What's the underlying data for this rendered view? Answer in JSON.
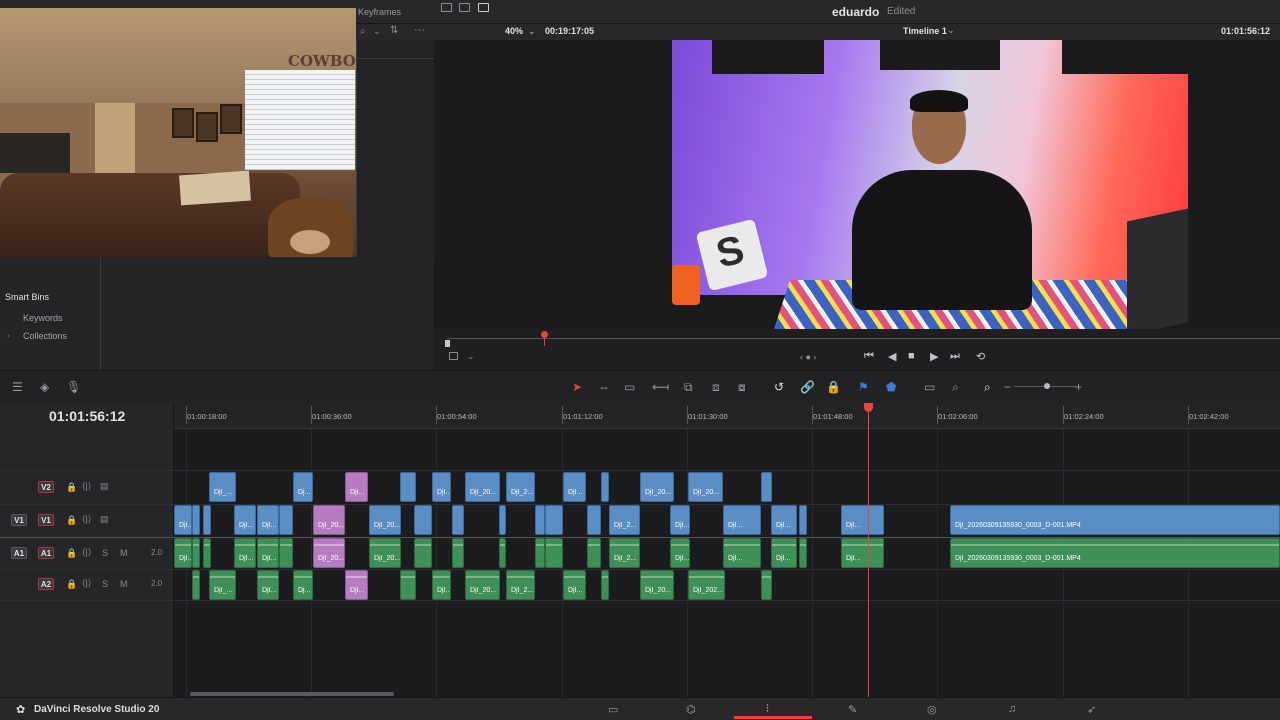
{
  "app": {
    "name": "DaVinci Resolve Studio 20"
  },
  "project": {
    "name": "eduardo",
    "status": "Edited"
  },
  "inspector": {
    "keyframes_label": "Keyframes"
  },
  "viewer": {
    "zoom": "40%",
    "source_timecode": "00:19:17:05",
    "timeline_name": "Timeline 1",
    "record_timecode": "01:01:56:12"
  },
  "media": {
    "smart_bins_title": "Smart Bins",
    "items": [
      {
        "label": "Keywords"
      },
      {
        "label": "Collections"
      }
    ]
  },
  "timeline": {
    "timecode": "01:01:56:12",
    "ruler": [
      "01:00:18:00",
      "01:00:36:00",
      "01:00:54:00",
      "01:01:12:00",
      "01:01:30:00",
      "01:01:48:00",
      "01:02:06:00",
      "01:02:24:00",
      "01:02:42:00"
    ],
    "tracks": [
      {
        "id": "V2",
        "type": "video",
        "clips": [
          {
            "label": "DjI_..."
          },
          {
            "label": "Dj..."
          },
          {
            "label": "DjI..."
          },
          {
            "label": ""
          },
          {
            "label": "DjI..."
          },
          {
            "label": "DjI_20..."
          },
          {
            "label": "DjI_2..."
          },
          {
            "label": "DjI..."
          },
          {
            "label": ""
          },
          {
            "label": "DjI_20..."
          },
          {
            "label": "DjI_20..."
          },
          {
            "label": ""
          }
        ]
      },
      {
        "id": "V1",
        "dest": "V1",
        "type": "video",
        "clips": [
          {
            "label": "DjI..."
          },
          {
            "label": ""
          },
          {
            "label": "DjI..."
          },
          {
            "label": "DjI..."
          },
          {
            "label": ""
          },
          {
            "label": "DjI_20..."
          },
          {
            "label": "DjI_20..."
          },
          {
            "label": ""
          },
          {
            "label": ""
          },
          {
            "label": ""
          },
          {
            "label": ""
          },
          {
            "label": ""
          },
          {
            "label": "DjI_2..."
          },
          {
            "label": "DjI..."
          },
          {
            "label": "DjI..."
          },
          {
            "label": "DjI..."
          },
          {
            "label": ""
          },
          {
            "label": "DjI..."
          },
          {
            "label": "DjI_20260309135930_0003_D-001.MP4"
          }
        ]
      },
      {
        "id": "A1",
        "dest": "A1",
        "type": "audio",
        "channels": "2.0",
        "clips": [
          {
            "label": "DjI..."
          },
          {
            "label": ""
          },
          {
            "label": "DjI..."
          },
          {
            "label": "DjI..."
          },
          {
            "label": ""
          },
          {
            "label": "DjI_20..."
          },
          {
            "label": "DjI_20..."
          },
          {
            "label": ""
          },
          {
            "label": ""
          },
          {
            "label": ""
          },
          {
            "label": ""
          },
          {
            "label": ""
          },
          {
            "label": "DjI_2..."
          },
          {
            "label": "DjI..."
          },
          {
            "label": "DjI..."
          },
          {
            "label": "DjI..."
          },
          {
            "label": ""
          },
          {
            "label": "DjI..."
          },
          {
            "label": "DjI_20260309135930_0003_D-001.MP4"
          }
        ]
      },
      {
        "id": "A2",
        "type": "audio",
        "channels": "2.0",
        "clips": [
          {
            "label": ""
          },
          {
            "label": "DjI_..."
          },
          {
            "label": "DjI..."
          },
          {
            "label": "Dj..."
          },
          {
            "label": "DjI..."
          },
          {
            "label": ""
          },
          {
            "label": "DjI..."
          },
          {
            "label": "DjI_20..."
          },
          {
            "label": "DjI_2..."
          },
          {
            "label": "DjI..."
          },
          {
            "label": ""
          },
          {
            "label": "DjI_20..."
          },
          {
            "label": "DjI_202..."
          },
          {
            "label": ""
          }
        ]
      }
    ]
  },
  "track_controls": {
    "solo": "S",
    "mute": "M"
  },
  "colors": {
    "video_clip": "#5a8ec4",
    "audio_clip": "#3f8f58",
    "alt_clip": "#b57dc0",
    "playhead": "#e8453c"
  },
  "pages": [
    "media-page-icon",
    "cut-page-icon",
    "edit-page-icon",
    "fusion-page-icon",
    "color-page-icon",
    "fairlight-page-icon",
    "deliver-page-icon"
  ],
  "active_page": "edit-page-icon"
}
